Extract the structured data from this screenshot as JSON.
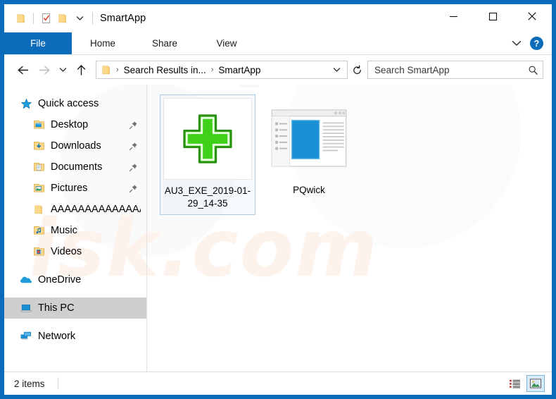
{
  "window": {
    "title": "SmartApp",
    "accent_color": "#0d6cb9",
    "quick_access": [
      {
        "name": "folder-icon",
        "label": "Folder"
      },
      {
        "name": "properties-icon",
        "label": "Properties"
      },
      {
        "name": "new-folder-icon",
        "label": "New folder"
      },
      {
        "name": "customize-dropdown-icon",
        "label": "Customize Quick Access Toolbar"
      }
    ],
    "controls": [
      {
        "name": "minimize-button",
        "label": "Minimize",
        "glyph": "—"
      },
      {
        "name": "maximize-button",
        "label": "Maximize",
        "glyph": "□"
      },
      {
        "name": "close-button",
        "label": "Close",
        "glyph": "✕"
      }
    ]
  },
  "ribbon": {
    "tabs": [
      {
        "label": "File",
        "selected": true
      },
      {
        "label": "Home",
        "selected": false
      },
      {
        "label": "Share",
        "selected": false
      },
      {
        "label": "View",
        "selected": false
      }
    ],
    "expand_icon": "chevron-down-icon",
    "help_label": "?"
  },
  "address": {
    "back_label": "Back",
    "forward_label": "Forward",
    "recent_label": "Recent locations",
    "up_label": "Up",
    "crumbs": [
      {
        "label": "Search Results in..."
      },
      {
        "label": "SmartApp"
      }
    ],
    "crumb_separator": "›",
    "dropdown_icon": "chevron-down-icon",
    "refresh_label": "Refresh",
    "refresh_glyph": "↻"
  },
  "search": {
    "placeholder": "Search SmartApp",
    "value": "",
    "icon": "search-icon"
  },
  "sidebar": {
    "items": [
      {
        "label": "Quick access",
        "icon": "star-icon",
        "level": "root",
        "pinned": false,
        "selected": false
      },
      {
        "label": "Desktop",
        "icon": "desktop-folder-icon",
        "level": "child",
        "pinned": true,
        "selected": false
      },
      {
        "label": "Downloads",
        "icon": "downloads-folder-icon",
        "level": "child",
        "pinned": true,
        "selected": false
      },
      {
        "label": "Documents",
        "icon": "documents-folder-icon",
        "level": "child",
        "pinned": true,
        "selected": false
      },
      {
        "label": "Pictures",
        "icon": "pictures-folder-icon",
        "level": "child",
        "pinned": true,
        "selected": false
      },
      {
        "label": "AAAAAAAAAAAAAAAA",
        "icon": "folder-icon",
        "level": "child",
        "pinned": false,
        "selected": false
      },
      {
        "label": "Music",
        "icon": "music-folder-icon",
        "level": "child",
        "pinned": false,
        "selected": false
      },
      {
        "label": "Videos",
        "icon": "videos-folder-icon",
        "level": "child",
        "pinned": false,
        "selected": false
      },
      {
        "label": "OneDrive",
        "icon": "onedrive-icon",
        "level": "root",
        "pinned": false,
        "selected": false,
        "gap_before": true
      },
      {
        "label": "This PC",
        "icon": "this-pc-icon",
        "level": "root",
        "pinned": false,
        "selected": true,
        "gap_before": true
      },
      {
        "label": "Network",
        "icon": "network-icon",
        "level": "root",
        "pinned": false,
        "selected": false,
        "gap_before": true
      }
    ]
  },
  "content": {
    "items": [
      {
        "name": "AU3_EXE_2019-01-29_14-35",
        "icon": "green-cross-icon",
        "selected": true
      },
      {
        "name": "PQwick",
        "icon": "document-window-icon",
        "selected": false
      }
    ]
  },
  "statusbar": {
    "item_count": "2 items",
    "views": [
      {
        "name": "details-view-button",
        "label": "Details view",
        "active": false
      },
      {
        "name": "large-icons-view-button",
        "label": "Large icons view",
        "active": true
      }
    ]
  },
  "watermark": {
    "text": "isk.com"
  }
}
